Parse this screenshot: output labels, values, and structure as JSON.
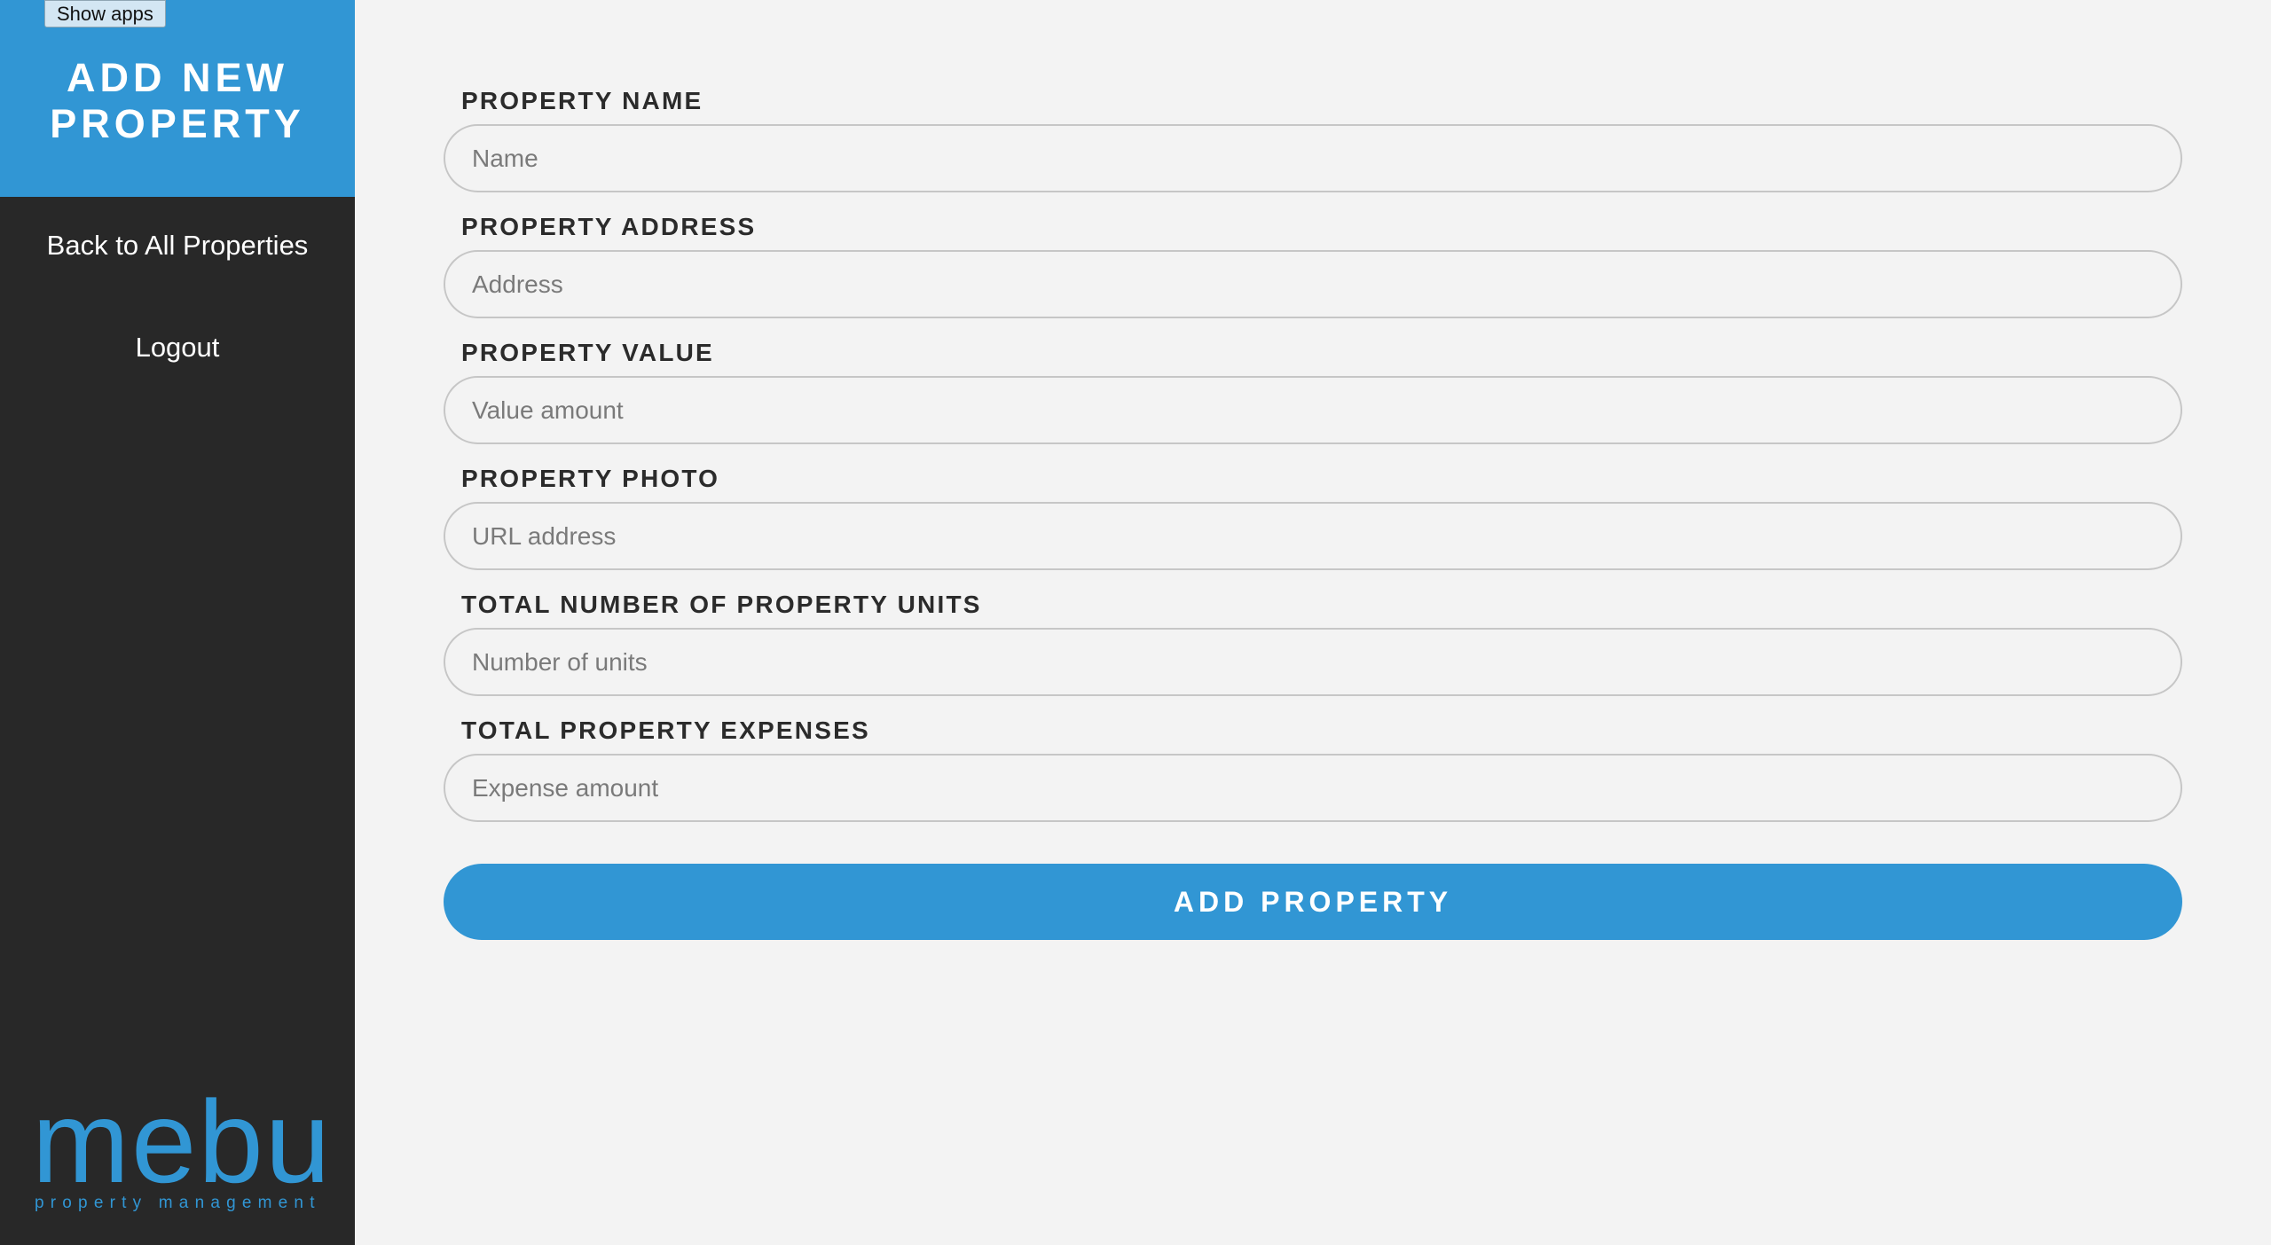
{
  "system": {
    "show_apps_label": "Show apps"
  },
  "sidebar": {
    "title": "ADD NEW PROPERTY",
    "nav": [
      {
        "label": "Back to All Properties"
      },
      {
        "label": "Logout"
      }
    ],
    "logo": {
      "word": "mebu",
      "tagline": "property management"
    }
  },
  "form": {
    "fields": [
      {
        "label": "PROPERTY NAME",
        "placeholder": "Name",
        "value": ""
      },
      {
        "label": "PROPERTY ADDRESS",
        "placeholder": "Address",
        "value": ""
      },
      {
        "label": "PROPERTY VALUE",
        "placeholder": "Value amount",
        "value": ""
      },
      {
        "label": "PROPERTY PHOTO",
        "placeholder": "URL address",
        "value": ""
      },
      {
        "label": "TOTAL NUMBER OF PROPERTY UNITS",
        "placeholder": "Number of units",
        "value": ""
      },
      {
        "label": "TOTAL PROPERTY EXPENSES",
        "placeholder": "Expense amount",
        "value": ""
      }
    ],
    "submit_label": "ADD PROPERTY"
  },
  "colors": {
    "accent": "#3196d4",
    "sidebar_bg": "#282828",
    "page_bg": "#f3f3f3"
  }
}
